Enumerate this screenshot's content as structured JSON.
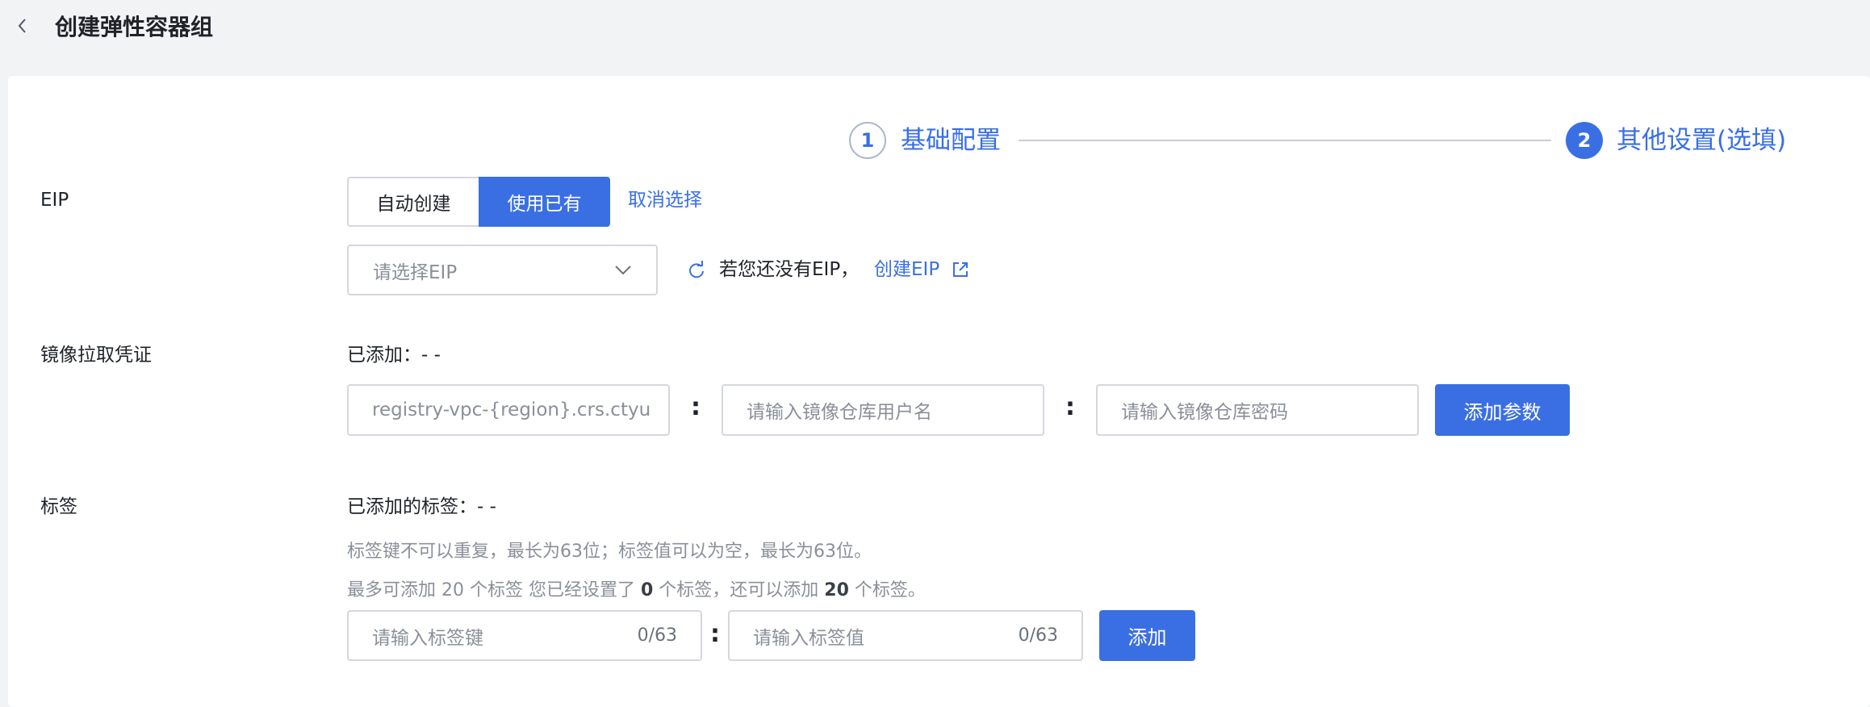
{
  "header": {
    "title": "创建弹性容器组"
  },
  "steps": [
    {
      "number": "1",
      "label": "基础配置"
    },
    {
      "number": "2",
      "label": "其他设置(选填)"
    }
  ],
  "eip": {
    "label": "EIP",
    "option_auto": "自动创建",
    "option_existing": "使用已有",
    "cancel_link": "取消选择",
    "select_placeholder": "请选择EIP",
    "no_eip_text": "若您还没有EIP，",
    "create_link": "创建EIP"
  },
  "registry": {
    "label": "镜像拉取凭证",
    "added_text": "已添加：- -",
    "server_value": "registry-vpc-{region}.crs.ctyu",
    "username_placeholder": "请输入镜像仓库用户名",
    "password_placeholder": "请输入镜像仓库密码",
    "add_button": "添加参数"
  },
  "tags": {
    "label": "标签",
    "added_text": "已添加的标签：- -",
    "rule_hint": "标签键不可以重复，最长为63位；标签值可以为空，最长为63位。",
    "limit_prefix": "最多可添加 20 个标签 您已经设置了 ",
    "limit_set_count": "0",
    "limit_middle": " 个标签，还可以添加 ",
    "limit_remaining": "20",
    "limit_suffix": " 个标签。",
    "key_placeholder": "请输入标签键",
    "key_count": "0/63",
    "value_placeholder": "请输入标签值",
    "value_count": "0/63",
    "add_button": "添加"
  },
  "colors": {
    "primary": "#3a6fe4",
    "border": "#d4d7dd",
    "background": "#f2f3f5"
  }
}
